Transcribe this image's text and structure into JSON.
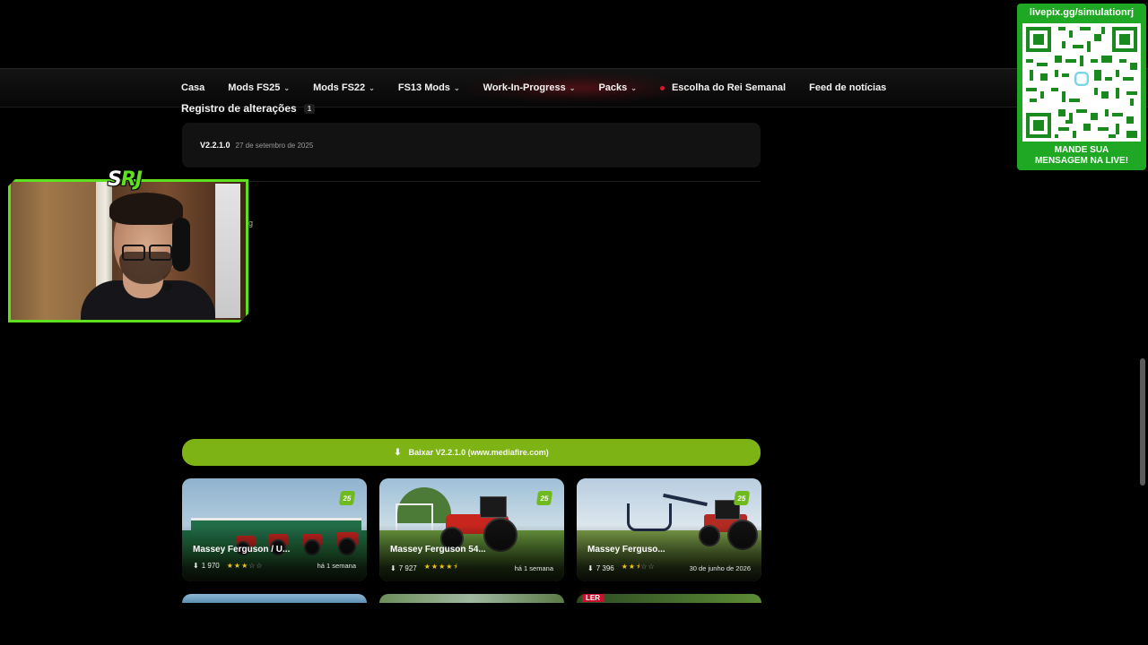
{
  "nav": {
    "items": [
      {
        "label": "Casa",
        "has_dropdown": false
      },
      {
        "label": "Mods FS25",
        "has_dropdown": true
      },
      {
        "label": "Mods FS22",
        "has_dropdown": true
      },
      {
        "label": "FS13 Mods",
        "has_dropdown": true
      },
      {
        "label": "Work-In-Progress",
        "has_dropdown": true
      },
      {
        "label": "Packs",
        "has_dropdown": true
      },
      {
        "label": "Escolha do Rei Semanal",
        "has_dropdown": false,
        "live_dot": true
      },
      {
        "label": "Feed de notícias",
        "has_dropdown": false
      }
    ],
    "chevron": "⌄"
  },
  "changelog": {
    "title": "Registro de alterações",
    "count": "1",
    "entries": [
      {
        "version": "V2.2.1.0",
        "date": "27 de setembro de 2025"
      }
    ]
  },
  "partial_text": "ing",
  "download": {
    "label": "Baixar V2.2.1.0 (www.mediafire.com)",
    "icon": "download-icon"
  },
  "cards": [
    {
      "title": "Massey Ferguson / U...",
      "downloads": "1 970",
      "rating": 3,
      "when": "há 1 semana",
      "badge": "25"
    },
    {
      "title": "Massey Ferguson 54...",
      "downloads": "7 927",
      "rating": 4.5,
      "when": "há 1 semana",
      "badge": "25"
    },
    {
      "title": "Massey Ferguso...",
      "downloads": "7 396",
      "rating": 2.5,
      "when": "30 de junho de 2026",
      "badge": "25"
    }
  ],
  "partial_cards": [
    {
      "badge_text": "LER"
    }
  ],
  "overlay": {
    "logo_s": "S",
    "logo_rj": "RJ",
    "qr_url": "livepix.gg/simulationrj",
    "qr_caption_line1": "MANDE SUA",
    "qr_caption_line2": "MENSAGEM NA LIVE!"
  },
  "colors": {
    "accent_green": "#7eb315",
    "overlay_green": "#1fa824",
    "webcam_border": "#5fe01f",
    "star": "#f0c419",
    "live_dot": "#d01b2a"
  }
}
